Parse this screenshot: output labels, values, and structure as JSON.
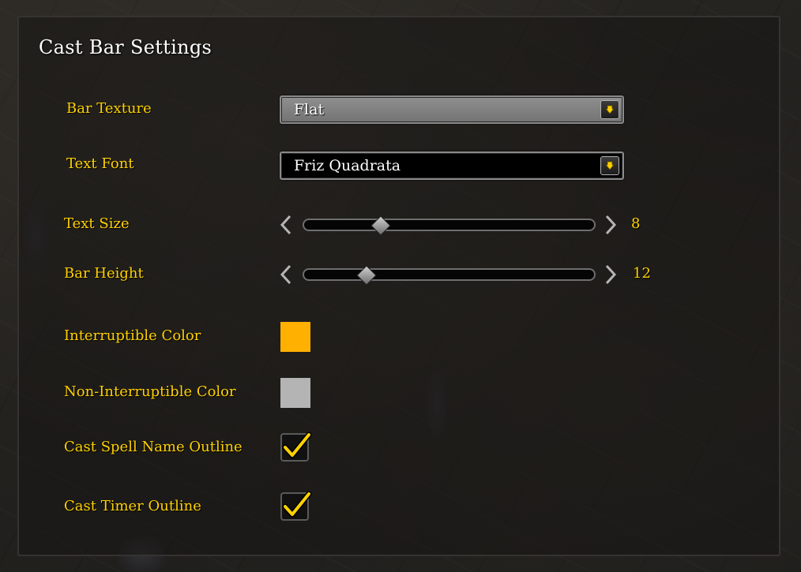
{
  "panel": {
    "title": "Cast Bar Settings"
  },
  "settings": {
    "bar_texture": {
      "label": "Bar Texture",
      "value": "Flat"
    },
    "text_font": {
      "label": "Text Font",
      "value": "Friz Quadrata"
    },
    "text_size": {
      "label": "Text Size",
      "value": "8"
    },
    "bar_height": {
      "label": "Bar Height",
      "value": "12"
    },
    "interruptible_color": {
      "label": "Interruptible Color",
      "color": "#ffb000"
    },
    "non_interruptible_color": {
      "label": "Non-Interruptible Color",
      "color": "#b4b4b4"
    },
    "cast_spell_name_outline": {
      "label": "Cast Spell Name Outline",
      "checked": true
    },
    "cast_timer_outline": {
      "label": "Cast Timer Outline",
      "checked": true
    }
  },
  "icons": {
    "dropdown_arrow": "chevron-down-icon",
    "slider_left": "chevron-left-icon",
    "slider_right": "chevron-right-icon",
    "check": "checkmark-icon"
  },
  "colors": {
    "label": "#ffd100",
    "title": "#ffffff"
  }
}
